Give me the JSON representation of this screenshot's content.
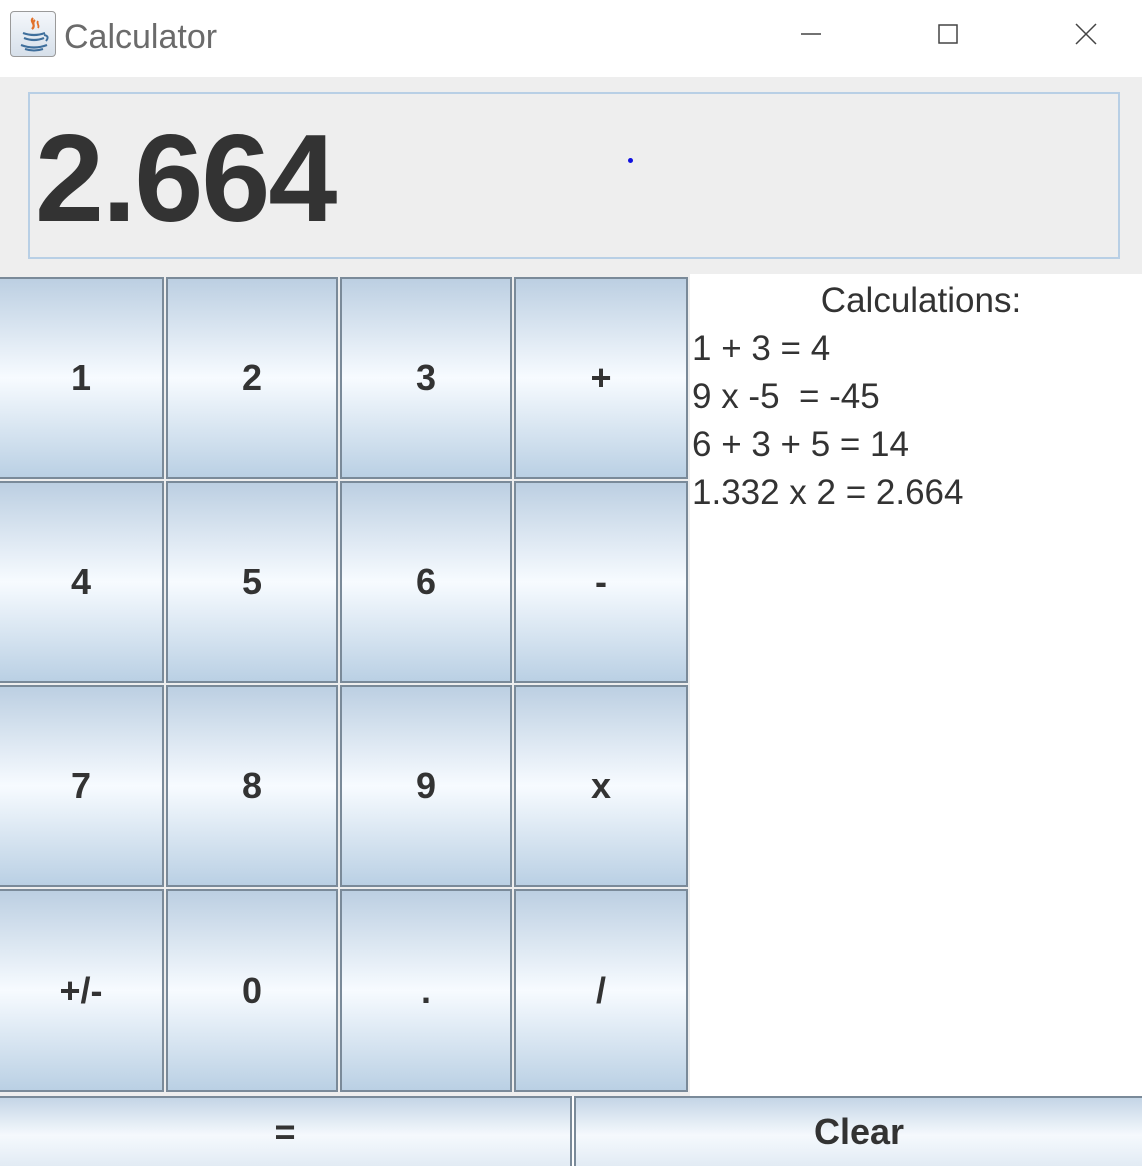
{
  "window": {
    "title": "Calculator",
    "icon": "java-cup-icon",
    "controls": [
      "minimize-icon",
      "maximize-icon",
      "close-icon"
    ]
  },
  "display": {
    "value": "2.664"
  },
  "keypad": {
    "rows": [
      [
        "1",
        "2",
        "3",
        "+"
      ],
      [
        "4",
        "5",
        "6",
        "-"
      ],
      [
        "7",
        "8",
        "9",
        "x"
      ],
      [
        "+/-",
        "0",
        ".",
        "/"
      ]
    ]
  },
  "history": {
    "heading": "Calculations:",
    "lines": [
      "1 + 3 = 4",
      "9 x -5  = -45",
      "6 + 3 + 5 = 14",
      "1.332 x 2 = 2.664"
    ]
  },
  "bottom": {
    "equals_label": "=",
    "clear_label": "Clear"
  },
  "colors": {
    "key_gradient_light": "#f7fbff",
    "key_gradient_dark": "#bccfe2",
    "text": "#333333",
    "display_border": "#b8cfe5"
  }
}
